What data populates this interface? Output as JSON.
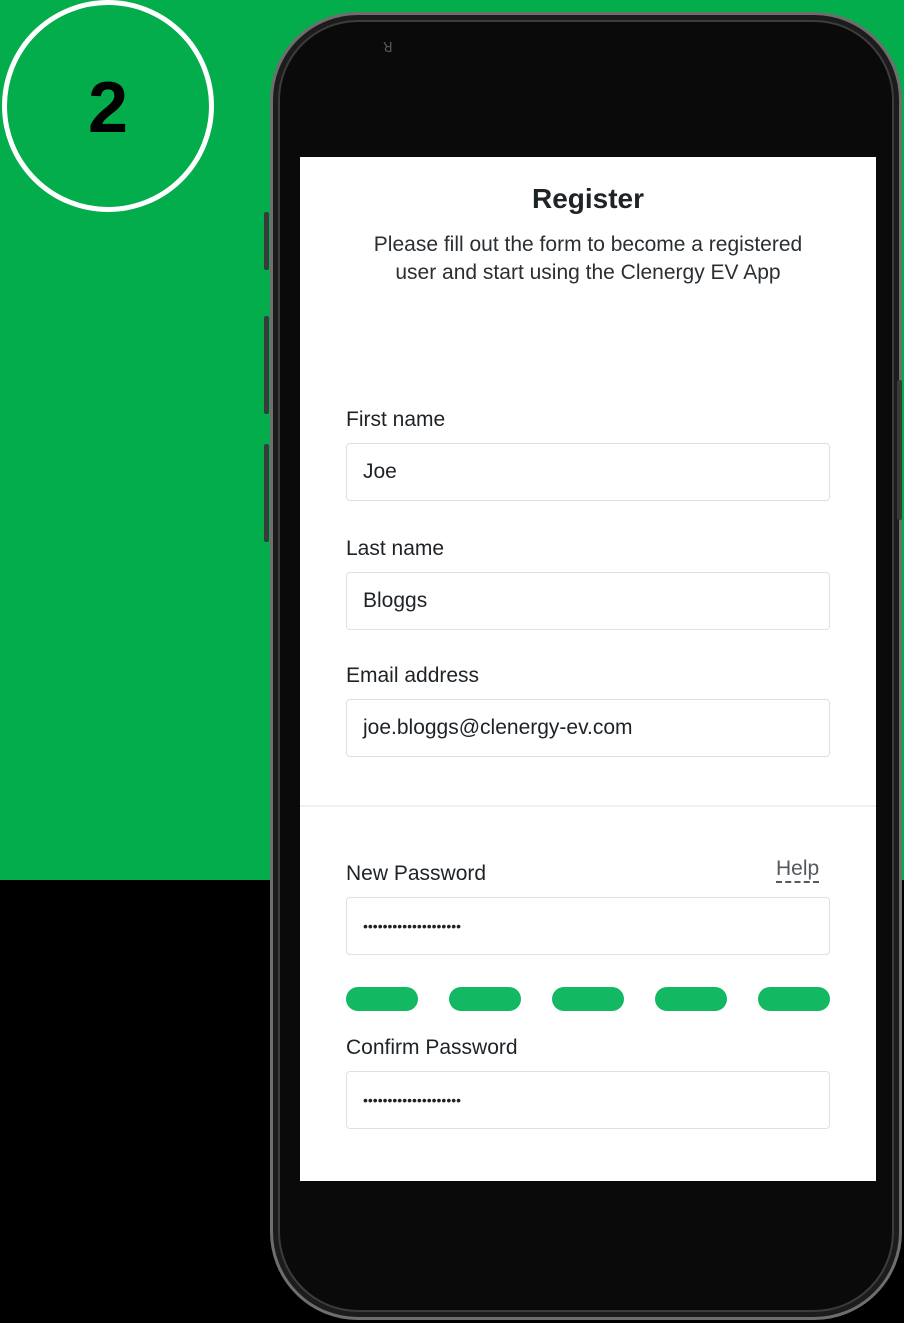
{
  "step_badge": {
    "number": "2"
  },
  "register": {
    "title": "Register",
    "subtitle": "Please fill out the form to become a registered user and start using the Clenergy EV App"
  },
  "fields": {
    "first_name": {
      "label": "First name",
      "value": "Joe"
    },
    "last_name": {
      "label": "Last name",
      "value": "Bloggs"
    },
    "email": {
      "label": "Email address",
      "value": "joe.bloggs@clenergy-ev.com"
    },
    "new_password": {
      "label": "New Password",
      "value": "••••••••••••••••••••",
      "help": "Help"
    },
    "confirm_password": {
      "label": "Confirm Password",
      "value": "••••••••••••••••••••"
    }
  },
  "password_strength": {
    "level": 5,
    "max": 5,
    "color": "#12b862"
  },
  "colors": {
    "background_green": "#04ad4c",
    "strength_green": "#12b862",
    "text": "#1e2327"
  }
}
